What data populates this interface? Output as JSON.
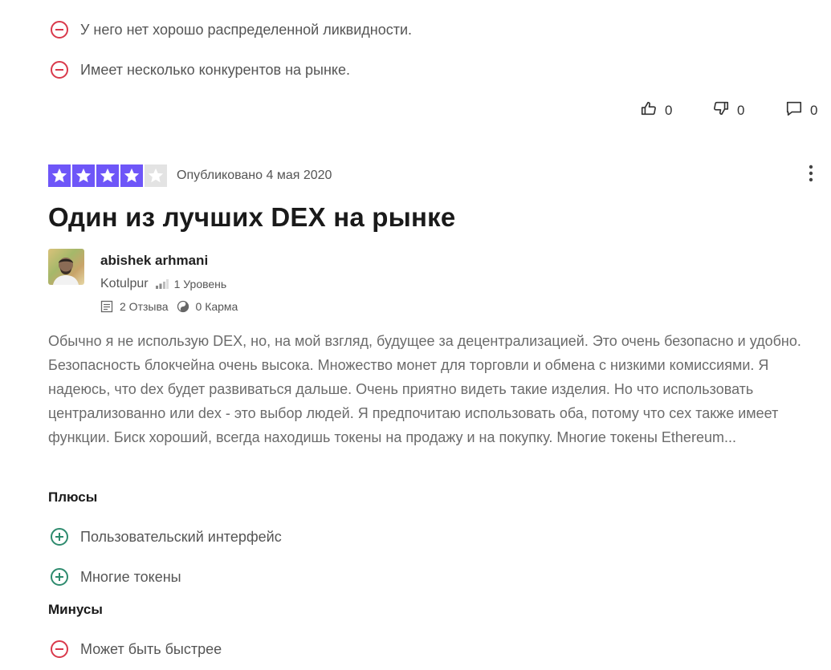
{
  "prev_review": {
    "cons": [
      "У него нет хорошо распределенной ликвидности.",
      "Имеет несколько конкурентов на рынке."
    ],
    "actions": {
      "likes": "0",
      "dislikes": "0",
      "comments": "0"
    }
  },
  "review": {
    "rating": 4,
    "rating_max": 5,
    "published": "Опубликовано 4 мая 2020",
    "title": "Один из лучших DEX на рынке",
    "author": {
      "name": "abishek  arhmani",
      "city": "Kotulpur",
      "level": "1 Уровень",
      "reviews": "2 Отзыва",
      "karma": "0 Карма"
    },
    "body": "Обычно я не использую DEX, но, на мой взгляд, будущее за децентрализацией. Это очень безопасно и удобно. Безопасность блокчейна очень высока. Множество монет для торговли и обмена с низкими комиссиями. Я надеюсь, что dex будет развиваться дальше. Очень приятно видеть такие изделия. Но что использовать централизованно или dex - это выбор людей. Я предпочитаю использовать оба, потому что cex также имеет функции. Биск хороший, всегда находишь токены на продажу и на покупку. Многие токены Ethereum...",
    "pros_heading": "Плюсы",
    "pros": [
      "Пользовательский интерфейс",
      "Многие токены"
    ],
    "cons_heading": "Минусы",
    "cons": [
      "Может быть быстрее"
    ]
  },
  "colors": {
    "star": "#6e56f8",
    "minus": "#d9394b",
    "plus": "#2e8b6e"
  },
  "icons": [
    "minus-circle-icon",
    "plus-circle-icon",
    "thumbs-up-icon",
    "thumbs-down-icon",
    "comment-icon",
    "more-vertical-icon",
    "star-icon",
    "level-bars-icon",
    "document-icon",
    "karma-icon"
  ]
}
